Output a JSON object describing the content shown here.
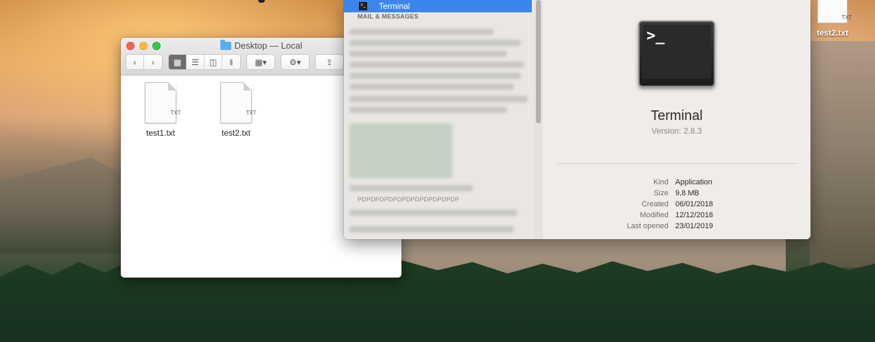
{
  "finder": {
    "title": "Desktop — Local",
    "files": [
      {
        "name": "test1.txt",
        "ext": "TXT"
      },
      {
        "name": "test2.txt",
        "ext": "TXT"
      }
    ]
  },
  "app_panel": {
    "selected_item": "Terminal",
    "section_label": "MAIL & MESSAGES",
    "blurred_label": "PDPDPDPDPDPDPDPDPDPDPDP",
    "app_name": "Terminal",
    "version": "Version: 2.8.3",
    "info": [
      {
        "key": "Kind",
        "value": "Application"
      },
      {
        "key": "Size",
        "value": "9,8 MB"
      },
      {
        "key": "Created",
        "value": "06/01/2018"
      },
      {
        "key": "Modified",
        "value": "12/12/2018"
      },
      {
        "key": "Last opened",
        "value": "23/01/2019"
      }
    ]
  },
  "desktop": {
    "file_name": "test2.txt",
    "file_ext": "TXT"
  }
}
